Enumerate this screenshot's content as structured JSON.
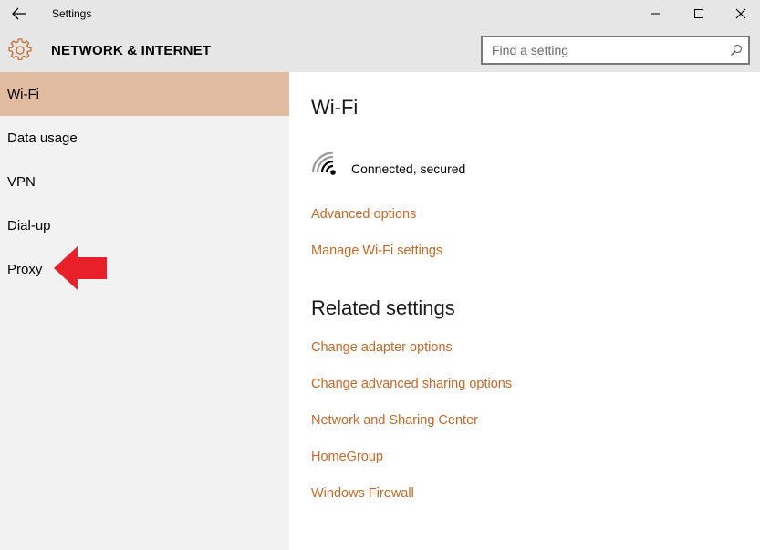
{
  "window": {
    "title": "Settings",
    "minimize_symbol": "—",
    "maximize_symbol": "☐",
    "close_symbol": "✕"
  },
  "header": {
    "section_title": "NETWORK & INTERNET",
    "search_placeholder": "Find a setting",
    "accent_color": "#c0692a"
  },
  "sidebar": {
    "selected_color": "#e0bba0",
    "items": [
      {
        "label": "Wi-Fi",
        "selected": true
      },
      {
        "label": "Data usage",
        "selected": false
      },
      {
        "label": "VPN",
        "selected": false
      },
      {
        "label": "Dial-up",
        "selected": false
      },
      {
        "label": "Proxy",
        "selected": false
      }
    ]
  },
  "annotation": {
    "arrow_color": "#e8202a"
  },
  "main": {
    "heading": "Wi-Fi",
    "connection_status": "Connected, secured",
    "wifi_links": [
      "Advanced options",
      "Manage Wi-Fi settings"
    ],
    "related_heading": "Related settings",
    "related_links": [
      "Change adapter options",
      "Change advanced sharing options",
      "Network and Sharing Center",
      "HomeGroup",
      "Windows Firewall"
    ]
  }
}
